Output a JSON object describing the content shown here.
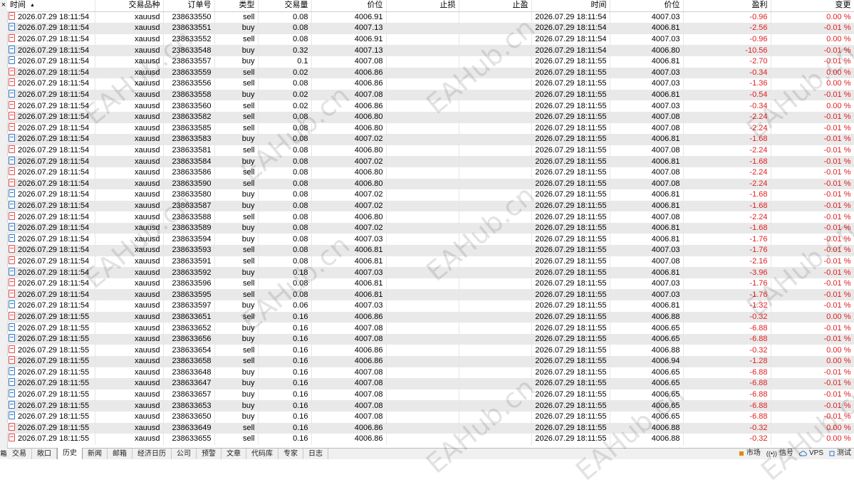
{
  "panel": {
    "close_glyph": "×",
    "side_label": "箱"
  },
  "columns": [
    "时间",
    "交易品种",
    "订单号",
    "类型",
    "交易量",
    "价位",
    "止损",
    "止盈",
    "时间",
    "价位",
    "盈利",
    "变更"
  ],
  "rows": [
    {
      "t": "2026.07.29 18:11:54",
      "s": "xauusd",
      "o": "238633550",
      "ty": "sell",
      "v": "0.08",
      "p": "4006.91",
      "sl": "",
      "tp": "",
      "t2": "2026.07.29 18:11:54",
      "p2": "4007.03",
      "pr": "-0.96",
      "ch": "0.00 %"
    },
    {
      "t": "2026.07.29 18:11:54",
      "s": "xauusd",
      "o": "238633551",
      "ty": "buy",
      "v": "0.08",
      "p": "4007.13",
      "sl": "",
      "tp": "",
      "t2": "2026.07.29 18:11:54",
      "p2": "4006.81",
      "pr": "-2.56",
      "ch": "-0.01 %"
    },
    {
      "t": "2026.07.29 18:11:54",
      "s": "xauusd",
      "o": "238633552",
      "ty": "sell",
      "v": "0.08",
      "p": "4006.91",
      "sl": "",
      "tp": "",
      "t2": "2026.07.29 18:11:54",
      "p2": "4007.03",
      "pr": "-0.96",
      "ch": "0.00 %"
    },
    {
      "t": "2026.07.29 18:11:54",
      "s": "xauusd",
      "o": "238633548",
      "ty": "buy",
      "v": "0.32",
      "p": "4007.13",
      "sl": "",
      "tp": "",
      "t2": "2026.07.29 18:11:54",
      "p2": "4006.80",
      "pr": "-10.56",
      "ch": "-0.01 %"
    },
    {
      "t": "2026.07.29 18:11:54",
      "s": "xauusd",
      "o": "238633557",
      "ty": "buy",
      "v": "0.1",
      "p": "4007.08",
      "sl": "",
      "tp": "",
      "t2": "2026.07.29 18:11:55",
      "p2": "4006.81",
      "pr": "-2.70",
      "ch": "-0.01 %"
    },
    {
      "t": "2026.07.29 18:11:54",
      "s": "xauusd",
      "o": "238633559",
      "ty": "sell",
      "v": "0.02",
      "p": "4006.86",
      "sl": "",
      "tp": "",
      "t2": "2026.07.29 18:11:55",
      "p2": "4007.03",
      "pr": "-0.34",
      "ch": "0.00 %"
    },
    {
      "t": "2026.07.29 18:11:54",
      "s": "xauusd",
      "o": "238633556",
      "ty": "sell",
      "v": "0.08",
      "p": "4006.86",
      "sl": "",
      "tp": "",
      "t2": "2026.07.29 18:11:55",
      "p2": "4007.03",
      "pr": "-1.36",
      "ch": "0.00 %"
    },
    {
      "t": "2026.07.29 18:11:54",
      "s": "xauusd",
      "o": "238633558",
      "ty": "buy",
      "v": "0.02",
      "p": "4007.08",
      "sl": "",
      "tp": "",
      "t2": "2026.07.29 18:11:55",
      "p2": "4006.81",
      "pr": "-0.54",
      "ch": "-0.01 %"
    },
    {
      "t": "2026.07.29 18:11:54",
      "s": "xauusd",
      "o": "238633560",
      "ty": "sell",
      "v": "0.02",
      "p": "4006.86",
      "sl": "",
      "tp": "",
      "t2": "2026.07.29 18:11:55",
      "p2": "4007.03",
      "pr": "-0.34",
      "ch": "0.00 %"
    },
    {
      "t": "2026.07.29 18:11:54",
      "s": "xauusd",
      "o": "238633582",
      "ty": "sell",
      "v": "0.08",
      "p": "4006.80",
      "sl": "",
      "tp": "",
      "t2": "2026.07.29 18:11:55",
      "p2": "4007.08",
      "pr": "-2.24",
      "ch": "-0.01 %"
    },
    {
      "t": "2026.07.29 18:11:54",
      "s": "xauusd",
      "o": "238633585",
      "ty": "sell",
      "v": "0.08",
      "p": "4006.80",
      "sl": "",
      "tp": "",
      "t2": "2026.07.29 18:11:55",
      "p2": "4007.08",
      "pr": "-2.24",
      "ch": "-0.01 %"
    },
    {
      "t": "2026.07.29 18:11:54",
      "s": "xauusd",
      "o": "238633583",
      "ty": "buy",
      "v": "0.08",
      "p": "4007.02",
      "sl": "",
      "tp": "",
      "t2": "2026.07.29 18:11:55",
      "p2": "4006.81",
      "pr": "-1.68",
      "ch": "-0.01 %"
    },
    {
      "t": "2026.07.29 18:11:54",
      "s": "xauusd",
      "o": "238633581",
      "ty": "sell",
      "v": "0.08",
      "p": "4006.80",
      "sl": "",
      "tp": "",
      "t2": "2026.07.29 18:11:55",
      "p2": "4007.08",
      "pr": "-2.24",
      "ch": "-0.01 %"
    },
    {
      "t": "2026.07.29 18:11:54",
      "s": "xauusd",
      "o": "238633584",
      "ty": "buy",
      "v": "0.08",
      "p": "4007.02",
      "sl": "",
      "tp": "",
      "t2": "2026.07.29 18:11:55",
      "p2": "4006.81",
      "pr": "-1.68",
      "ch": "-0.01 %"
    },
    {
      "t": "2026.07.29 18:11:54",
      "s": "xauusd",
      "o": "238633586",
      "ty": "sell",
      "v": "0.08",
      "p": "4006.80",
      "sl": "",
      "tp": "",
      "t2": "2026.07.29 18:11:55",
      "p2": "4007.08",
      "pr": "-2.24",
      "ch": "-0.01 %"
    },
    {
      "t": "2026.07.29 18:11:54",
      "s": "xauusd",
      "o": "238633590",
      "ty": "sell",
      "v": "0.08",
      "p": "4006.80",
      "sl": "",
      "tp": "",
      "t2": "2026.07.29 18:11:55",
      "p2": "4007.08",
      "pr": "-2.24",
      "ch": "-0.01 %"
    },
    {
      "t": "2026.07.29 18:11:54",
      "s": "xauusd",
      "o": "238633580",
      "ty": "buy",
      "v": "0.08",
      "p": "4007.02",
      "sl": "",
      "tp": "",
      "t2": "2026.07.29 18:11:55",
      "p2": "4006.81",
      "pr": "-1.68",
      "ch": "-0.01 %"
    },
    {
      "t": "2026.07.29 18:11:54",
      "s": "xauusd",
      "o": "238633587",
      "ty": "buy",
      "v": "0.08",
      "p": "4007.02",
      "sl": "",
      "tp": "",
      "t2": "2026.07.29 18:11:55",
      "p2": "4006.81",
      "pr": "-1.68",
      "ch": "-0.01 %"
    },
    {
      "t": "2026.07.29 18:11:54",
      "s": "xauusd",
      "o": "238633588",
      "ty": "sell",
      "v": "0.08",
      "p": "4006.80",
      "sl": "",
      "tp": "",
      "t2": "2026.07.29 18:11:55",
      "p2": "4007.08",
      "pr": "-2.24",
      "ch": "-0.01 %"
    },
    {
      "t": "2026.07.29 18:11:54",
      "s": "xauusd",
      "o": "238633589",
      "ty": "buy",
      "v": "0.08",
      "p": "4007.02",
      "sl": "",
      "tp": "",
      "t2": "2026.07.29 18:11:55",
      "p2": "4006.81",
      "pr": "-1.68",
      "ch": "-0.01 %"
    },
    {
      "t": "2026.07.29 18:11:54",
      "s": "xauusd",
      "o": "238633594",
      "ty": "buy",
      "v": "0.08",
      "p": "4007.03",
      "sl": "",
      "tp": "",
      "t2": "2026.07.29 18:11:55",
      "p2": "4006.81",
      "pr": "-1.76",
      "ch": "-0.01 %"
    },
    {
      "t": "2026.07.29 18:11:54",
      "s": "xauusd",
      "o": "238633593",
      "ty": "sell",
      "v": "0.08",
      "p": "4006.81",
      "sl": "",
      "tp": "",
      "t2": "2026.07.29 18:11:55",
      "p2": "4007.03",
      "pr": "-1.76",
      "ch": "-0.01 %"
    },
    {
      "t": "2026.07.29 18:11:54",
      "s": "xauusd",
      "o": "238633591",
      "ty": "sell",
      "v": "0.08",
      "p": "4006.81",
      "sl": "",
      "tp": "",
      "t2": "2026.07.29 18:11:55",
      "p2": "4007.08",
      "pr": "-2.16",
      "ch": "-0.01 %"
    },
    {
      "t": "2026.07.29 18:11:54",
      "s": "xauusd",
      "o": "238633592",
      "ty": "buy",
      "v": "0.18",
      "p": "4007.03",
      "sl": "",
      "tp": "",
      "t2": "2026.07.29 18:11:55",
      "p2": "4006.81",
      "pr": "-3.96",
      "ch": "-0.01 %"
    },
    {
      "t": "2026.07.29 18:11:54",
      "s": "xauusd",
      "o": "238633596",
      "ty": "sell",
      "v": "0.08",
      "p": "4006.81",
      "sl": "",
      "tp": "",
      "t2": "2026.07.29 18:11:55",
      "p2": "4007.03",
      "pr": "-1.76",
      "ch": "-0.01 %"
    },
    {
      "t": "2026.07.29 18:11:54",
      "s": "xauusd",
      "o": "238633595",
      "ty": "sell",
      "v": "0.08",
      "p": "4006.81",
      "sl": "",
      "tp": "",
      "t2": "2026.07.29 18:11:55",
      "p2": "4007.03",
      "pr": "-1.76",
      "ch": "-0.01 %"
    },
    {
      "t": "2026.07.29 18:11:54",
      "s": "xauusd",
      "o": "238633597",
      "ty": "buy",
      "v": "0.06",
      "p": "4007.03",
      "sl": "",
      "tp": "",
      "t2": "2026.07.29 18:11:55",
      "p2": "4006.81",
      "pr": "-1.32",
      "ch": "-0.01 %"
    },
    {
      "t": "2026.07.29 18:11:55",
      "s": "xauusd",
      "o": "238633651",
      "ty": "sell",
      "v": "0.16",
      "p": "4006.86",
      "sl": "",
      "tp": "",
      "t2": "2026.07.29 18:11:55",
      "p2": "4006.88",
      "pr": "-0.32",
      "ch": "0.00 %"
    },
    {
      "t": "2026.07.29 18:11:55",
      "s": "xauusd",
      "o": "238633652",
      "ty": "buy",
      "v": "0.16",
      "p": "4007.08",
      "sl": "",
      "tp": "",
      "t2": "2026.07.29 18:11:55",
      "p2": "4006.65",
      "pr": "-6.88",
      "ch": "-0.01 %"
    },
    {
      "t": "2026.07.29 18:11:55",
      "s": "xauusd",
      "o": "238633656",
      "ty": "buy",
      "v": "0.16",
      "p": "4007.08",
      "sl": "",
      "tp": "",
      "t2": "2026.07.29 18:11:55",
      "p2": "4006.65",
      "pr": "-6.88",
      "ch": "-0.01 %"
    },
    {
      "t": "2026.07.29 18:11:55",
      "s": "xauusd",
      "o": "238633654",
      "ty": "sell",
      "v": "0.16",
      "p": "4006.86",
      "sl": "",
      "tp": "",
      "t2": "2026.07.29 18:11:55",
      "p2": "4006.88",
      "pr": "-0.32",
      "ch": "0.00 %"
    },
    {
      "t": "2026.07.29 18:11:55",
      "s": "xauusd",
      "o": "238633658",
      "ty": "sell",
      "v": "0.16",
      "p": "4006.86",
      "sl": "",
      "tp": "",
      "t2": "2026.07.29 18:11:55",
      "p2": "4006.94",
      "pr": "-1.28",
      "ch": "0.00 %"
    },
    {
      "t": "2026.07.29 18:11:55",
      "s": "xauusd",
      "o": "238633648",
      "ty": "buy",
      "v": "0.16",
      "p": "4007.08",
      "sl": "",
      "tp": "",
      "t2": "2026.07.29 18:11:55",
      "p2": "4006.65",
      "pr": "-6.88",
      "ch": "-0.01 %"
    },
    {
      "t": "2026.07.29 18:11:55",
      "s": "xauusd",
      "o": "238633647",
      "ty": "buy",
      "v": "0.16",
      "p": "4007.08",
      "sl": "",
      "tp": "",
      "t2": "2026.07.29 18:11:55",
      "p2": "4006.65",
      "pr": "-6.88",
      "ch": "-0.01 %"
    },
    {
      "t": "2026.07.29 18:11:55",
      "s": "xauusd",
      "o": "238633657",
      "ty": "buy",
      "v": "0.16",
      "p": "4007.08",
      "sl": "",
      "tp": "",
      "t2": "2026.07.29 18:11:55",
      "p2": "4006.65",
      "pr": "-6.88",
      "ch": "-0.01 %"
    },
    {
      "t": "2026.07.29 18:11:55",
      "s": "xauusd",
      "o": "238633653",
      "ty": "buy",
      "v": "0.16",
      "p": "4007.08",
      "sl": "",
      "tp": "",
      "t2": "2026.07.29 18:11:55",
      "p2": "4006.65",
      "pr": "-6.88",
      "ch": "-0.01 %"
    },
    {
      "t": "2026.07.29 18:11:55",
      "s": "xauusd",
      "o": "238633650",
      "ty": "buy",
      "v": "0.16",
      "p": "4007.08",
      "sl": "",
      "tp": "",
      "t2": "2026.07.29 18:11:55",
      "p2": "4006.65",
      "pr": "-6.88",
      "ch": "-0.01 %"
    },
    {
      "t": "2026.07.29 18:11:55",
      "s": "xauusd",
      "o": "238633649",
      "ty": "sell",
      "v": "0.16",
      "p": "4006.86",
      "sl": "",
      "tp": "",
      "t2": "2026.07.29 18:11:55",
      "p2": "4006.88",
      "pr": "-0.32",
      "ch": "0.00 %"
    },
    {
      "t": "2026.07.29 18:11:55",
      "s": "xauusd",
      "o": "238633655",
      "ty": "sell",
      "v": "0.16",
      "p": "4006.86",
      "sl": "",
      "tp": "",
      "t2": "2026.07.29 18:11:55",
      "p2": "4006.88",
      "pr": "-0.32",
      "ch": "0.00 %"
    }
  ],
  "tabs": [
    "交易",
    "敞口",
    "历史",
    "新闻",
    "邮箱",
    "经济日历",
    "公司",
    "预警",
    "文章",
    "代码库",
    "专家",
    "日志"
  ],
  "active_tab": "历史",
  "status": {
    "market": "市场",
    "signals": "信号",
    "vps": "VPS",
    "tester": "测试"
  },
  "watermark": "EAHub.cn",
  "colors": {
    "loss": "#e02020",
    "sell_icon": "#e24b4b",
    "buy_icon": "#2d74c4",
    "row_alt": "#e9e9e9"
  }
}
